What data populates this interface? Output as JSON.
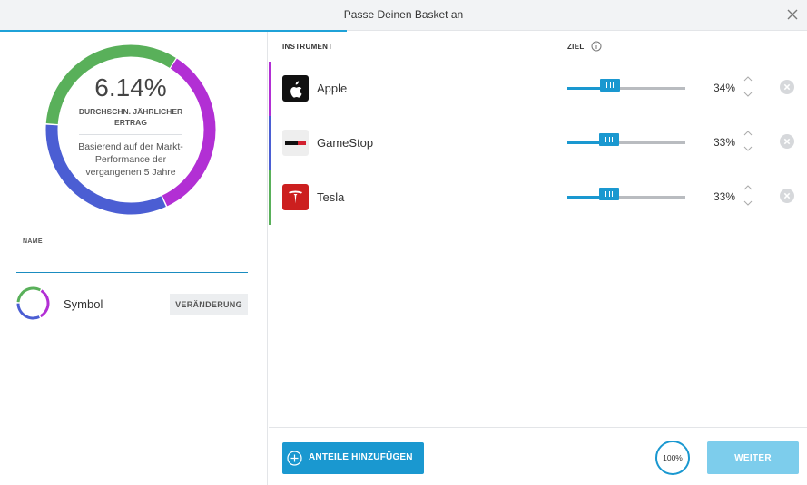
{
  "dialog": {
    "title": "Passe Deinen Basket an",
    "close_icon": "close-icon",
    "progress_percent": 43
  },
  "summary": {
    "annual_return": "6.14%",
    "annual_return_label": "DURCHSCHN. JÄHRLICHER ERTRAG",
    "note": "Basierend auf der Markt-Performance der vergangenen 5 Jahre",
    "donut_segments": [
      {
        "instrument": "Apple",
        "color": "#b22fd4",
        "fraction": 0.34
      },
      {
        "instrument": "GameStop",
        "color": "#4b5ed3",
        "fraction": 0.33
      },
      {
        "instrument": "Tesla",
        "color": "#59b05a",
        "fraction": 0.33
      }
    ]
  },
  "form": {
    "name_label": "NAME",
    "name_value": "",
    "symbol_label": "Symbol",
    "change_button": "VERÄNDERUNG"
  },
  "table": {
    "col_instrument": "INSTRUMENT",
    "col_target": "ZIEL",
    "info_icon": "info-icon",
    "rows": [
      {
        "name": "Apple",
        "percent": "34%",
        "value": 34,
        "color": "#b22fd4",
        "logo_bg": "#111111",
        "logo_icon": "apple-logo-icon"
      },
      {
        "name": "GameStop",
        "percent": "33%",
        "value": 33,
        "color": "#4b5ed3",
        "logo_bg": "#eeeeee",
        "logo_icon": "gamestop-logo-icon"
      },
      {
        "name": "Tesla",
        "percent": "33%",
        "value": 33,
        "color": "#59b05a",
        "logo_bg": "#cc1f1f",
        "logo_icon": "tesla-logo-icon"
      }
    ]
  },
  "footer": {
    "add_button": "ANTEILE HINZUFÜGEN",
    "total": "100%",
    "next_button": "WEITER"
  },
  "colors": {
    "accent": "#1a98d0",
    "accent_disabled": "#7dcdec"
  }
}
